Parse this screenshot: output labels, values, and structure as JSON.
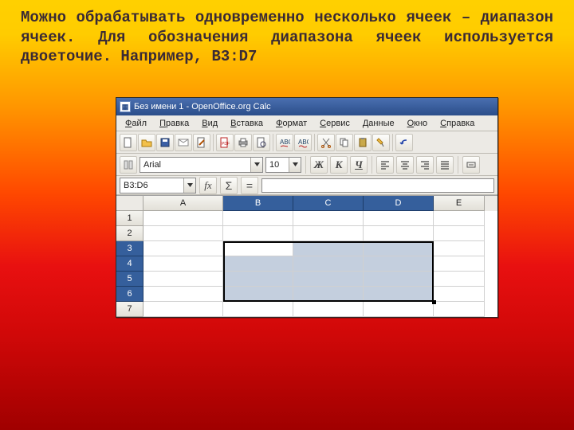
{
  "slideText": "Можно обрабатывать одновременно несколько ячеек – диапазон ячеек. Для обозначения диапазона ячеек используется двоеточие. Например, B3:D7",
  "window": {
    "title": "Без имени 1 - OpenOffice.org Calc"
  },
  "menu": [
    "Файл",
    "Правка",
    "Вид",
    "Вставка",
    "Формат",
    "Сервис",
    "Данные",
    "Окно",
    "Справка"
  ],
  "formatbar": {
    "font": "Arial",
    "size": "10",
    "bold": "Ж",
    "italic": "К",
    "underline": "Ч"
  },
  "formula": {
    "nameBox": "B3:D6",
    "fx": "fx",
    "sigma": "Σ",
    "eq": "="
  },
  "columns": [
    "A",
    "B",
    "C",
    "D",
    "E"
  ],
  "rows": [
    "1",
    "2",
    "3",
    "4",
    "5",
    "6",
    "7"
  ],
  "selection": {
    "startCol": "B",
    "endCol": "D",
    "startRow": 3,
    "endRow": 6
  },
  "colors": {
    "titlebar": "#2b4e8a",
    "selHead": "#355f9c",
    "selCell": "#c4cfde"
  }
}
